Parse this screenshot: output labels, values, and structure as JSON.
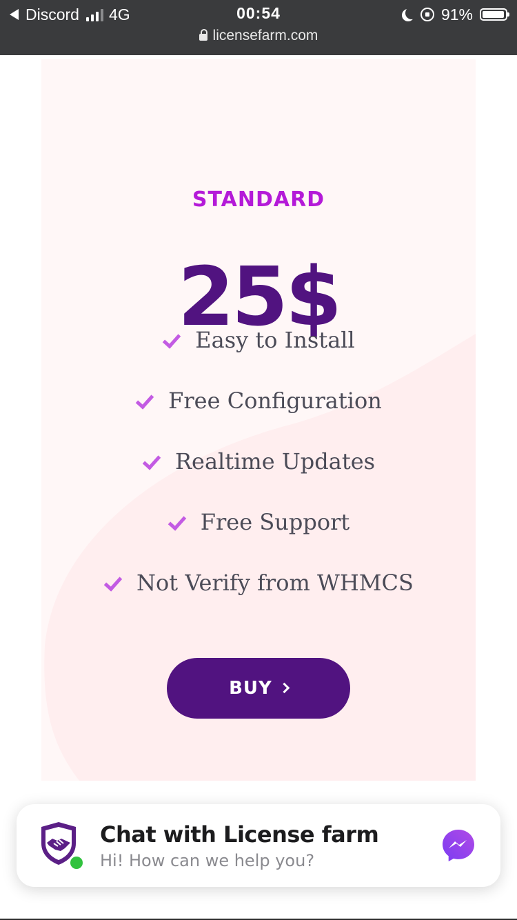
{
  "status_bar": {
    "back_app": "Discord",
    "network": "4G",
    "time": "00:54",
    "battery": "91%",
    "url": "licensefarm.com"
  },
  "card": {
    "plan_name": "STANDARD",
    "price": "25$",
    "features": [
      "Easy to Install",
      "Free Configuration",
      "Realtime Updates",
      "Free Support",
      "Not Verify from WHMCS"
    ],
    "buy_label": "BUY"
  },
  "chat": {
    "title": "Chat with License farm",
    "subtitle": "Hi! How can we help you?"
  },
  "colors": {
    "plan_accent": "#b41ad8",
    "price": "#511380",
    "check": "#c35be3",
    "button": "#511380",
    "card_bg": "#fff7f7",
    "messenger": "#9c3bf0",
    "online": "#31c23e"
  },
  "icons": {
    "status": [
      "back-arrow-icon",
      "signal-icon",
      "moon-icon",
      "rotation-lock-icon",
      "battery-icon",
      "lock-icon"
    ],
    "feature": "checkmark-icon",
    "button": "chevron-right-icon",
    "chat": [
      "shield-handshake-logo-icon",
      "messenger-icon"
    ]
  }
}
